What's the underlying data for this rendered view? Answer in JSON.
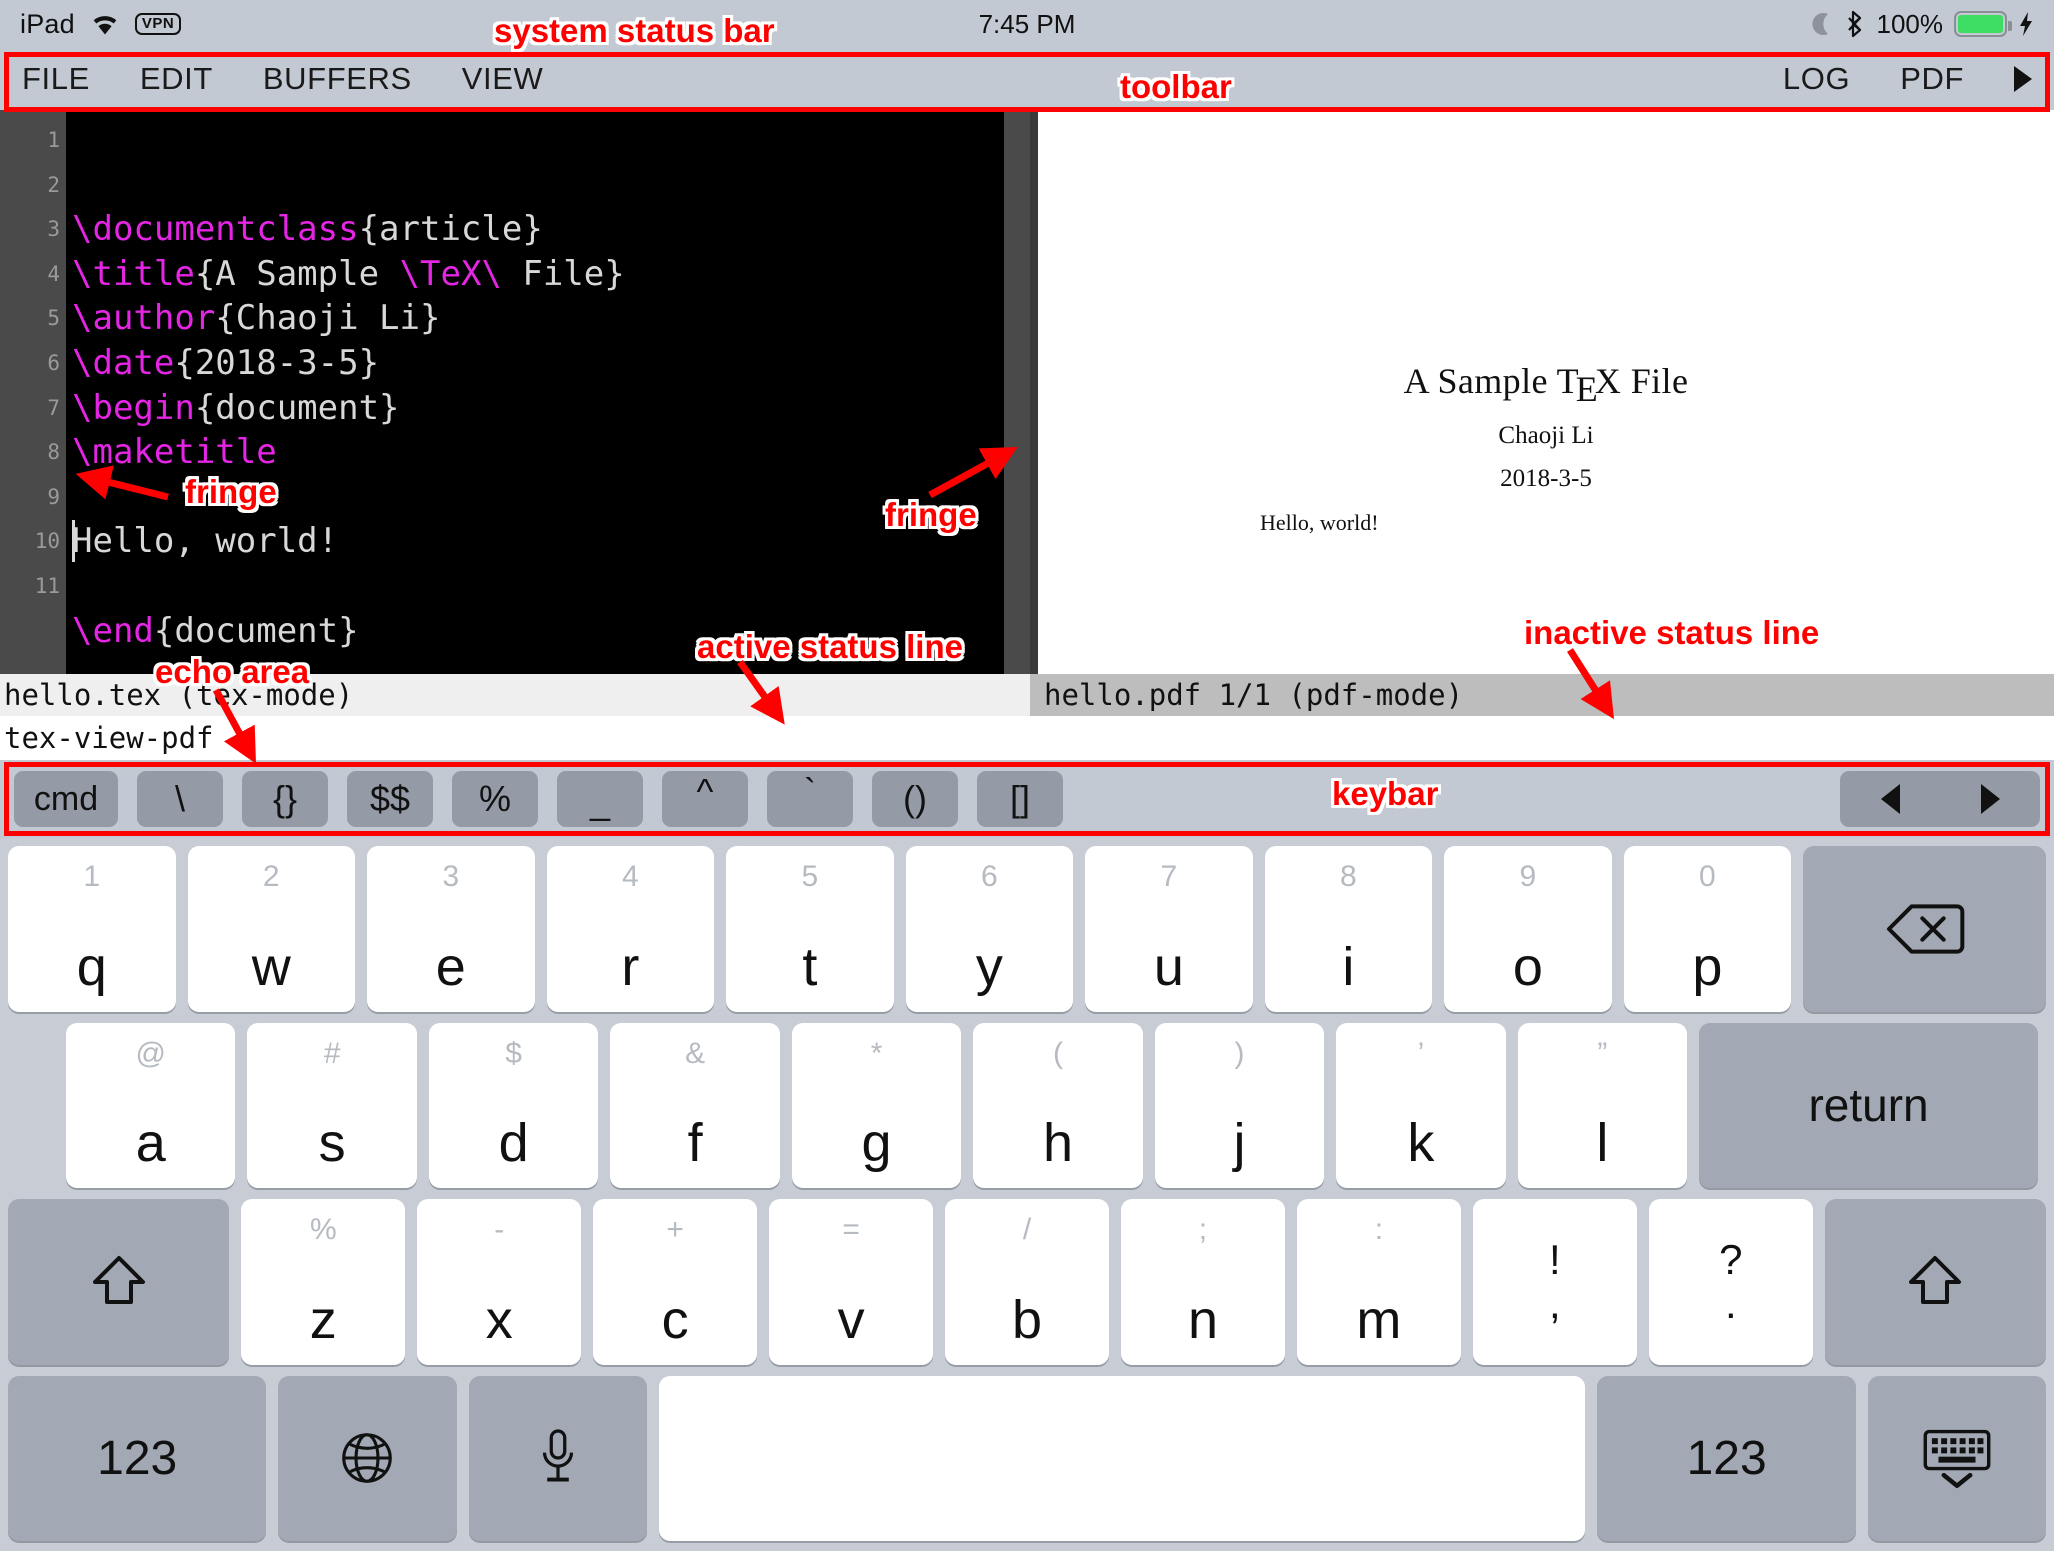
{
  "system_status_bar": {
    "device": "iPad",
    "wifi_icon": "wifi-icon",
    "vpn_badge": "VPN",
    "time": "7:45 PM",
    "moon_icon": "moon-icon",
    "bluetooth_icon": "bluetooth-icon",
    "battery_percent": "100%",
    "battery_color": "#3ddc63",
    "charging_icon": "lightning-bolt-icon"
  },
  "toolbar": {
    "left_items": [
      "FILE",
      "EDIT",
      "BUFFERS",
      "VIEW"
    ],
    "right_items": [
      "LOG",
      "PDF"
    ],
    "overflow_icon": "play-triangle-icon"
  },
  "editor": {
    "line_numbers": [
      "1",
      "2",
      "3",
      "4",
      "5",
      "6",
      "7",
      "8",
      "9",
      "10",
      "11"
    ],
    "lines": [
      [
        {
          "t": "\\documentclass",
          "c": "kw"
        },
        {
          "t": "{article}",
          "c": ""
        }
      ],
      [
        {
          "t": "\\title",
          "c": "kw"
        },
        {
          "t": "{A Sample ",
          "c": ""
        },
        {
          "t": "\\TeX\\",
          "c": "kw"
        },
        {
          "t": " File}",
          "c": ""
        }
      ],
      [
        {
          "t": "\\author",
          "c": "kw"
        },
        {
          "t": "{Chaoji Li}",
          "c": ""
        }
      ],
      [
        {
          "t": "\\date",
          "c": "kw"
        },
        {
          "t": "{2018-3-5}",
          "c": ""
        }
      ],
      [
        {
          "t": "\\begin",
          "c": "kw"
        },
        {
          "t": "{document}",
          "c": ""
        }
      ],
      [
        {
          "t": "\\maketitle",
          "c": "kw"
        }
      ],
      [],
      [
        {
          "t": "Hello, world!",
          "c": ""
        }
      ],
      [],
      [
        {
          "t": "\\end",
          "c": "kw"
        },
        {
          "t": "{document}",
          "c": ""
        }
      ],
      []
    ]
  },
  "pdf_preview": {
    "title_prefix": "A Sample T",
    "title_e": "E",
    "title_suffix": "X File",
    "author": "Chaoji Li",
    "date": "2018-3-5",
    "body": "Hello, world!"
  },
  "status_lines": {
    "active": "hello.tex (tex-mode)",
    "inactive": "hello.pdf 1/1 (pdf-mode)"
  },
  "echo_area": {
    "message": "tex-view-pdf"
  },
  "keybar": {
    "keys": [
      "cmd",
      "\\",
      "{}",
      "$$",
      "%",
      "_",
      "^",
      "`",
      "()",
      "[]"
    ],
    "nav_left_icon": "arrow-left-icon",
    "nav_right_icon": "arrow-right-icon"
  },
  "keyboard": {
    "row1": [
      {
        "alt": "1",
        "main": "q"
      },
      {
        "alt": "2",
        "main": "w"
      },
      {
        "alt": "3",
        "main": "e"
      },
      {
        "alt": "4",
        "main": "r"
      },
      {
        "alt": "5",
        "main": "t"
      },
      {
        "alt": "6",
        "main": "y"
      },
      {
        "alt": "7",
        "main": "u"
      },
      {
        "alt": "8",
        "main": "i"
      },
      {
        "alt": "9",
        "main": "o"
      },
      {
        "alt": "0",
        "main": "p"
      }
    ],
    "backspace_icon": "backspace-icon",
    "row2": [
      {
        "alt": "@",
        "main": "a"
      },
      {
        "alt": "#",
        "main": "s"
      },
      {
        "alt": "$",
        "main": "d"
      },
      {
        "alt": "&",
        "main": "f"
      },
      {
        "alt": "*",
        "main": "g"
      },
      {
        "alt": "(",
        "main": "h"
      },
      {
        "alt": ")",
        "main": "j"
      },
      {
        "alt": "’",
        "main": "k"
      },
      {
        "alt": "”",
        "main": "l"
      }
    ],
    "return_label": "return",
    "row3": [
      {
        "alt": "%",
        "main": "z"
      },
      {
        "alt": "-",
        "main": "x"
      },
      {
        "alt": "+",
        "main": "c"
      },
      {
        "alt": "=",
        "main": "v"
      },
      {
        "alt": "/",
        "main": "b"
      },
      {
        "alt": ";",
        "main": "n"
      },
      {
        "alt": ":",
        "main": "m"
      }
    ],
    "row3_punct": [
      {
        "top": "!",
        "bot": ","
      },
      {
        "top": "?",
        "bot": "."
      }
    ],
    "shift_left_icon": "shift-icon",
    "shift_right_icon": "shift-icon",
    "row4": {
      "numbers_left": "123",
      "globe_icon": "globe-icon",
      "mic_icon": "microphone-icon",
      "space": "",
      "numbers_right": "123",
      "dismiss_icon": "keyboard-dismiss-icon"
    }
  },
  "annotations": {
    "system_status_bar": "system status bar",
    "toolbar": "toolbar",
    "fringe_left": "fringe",
    "fringe_right": "fringe",
    "echo_area": "echo area",
    "active_status_line": "active status line",
    "inactive_status_line": "inactive status line",
    "keybar": "keybar",
    "color": "#ff0000"
  }
}
